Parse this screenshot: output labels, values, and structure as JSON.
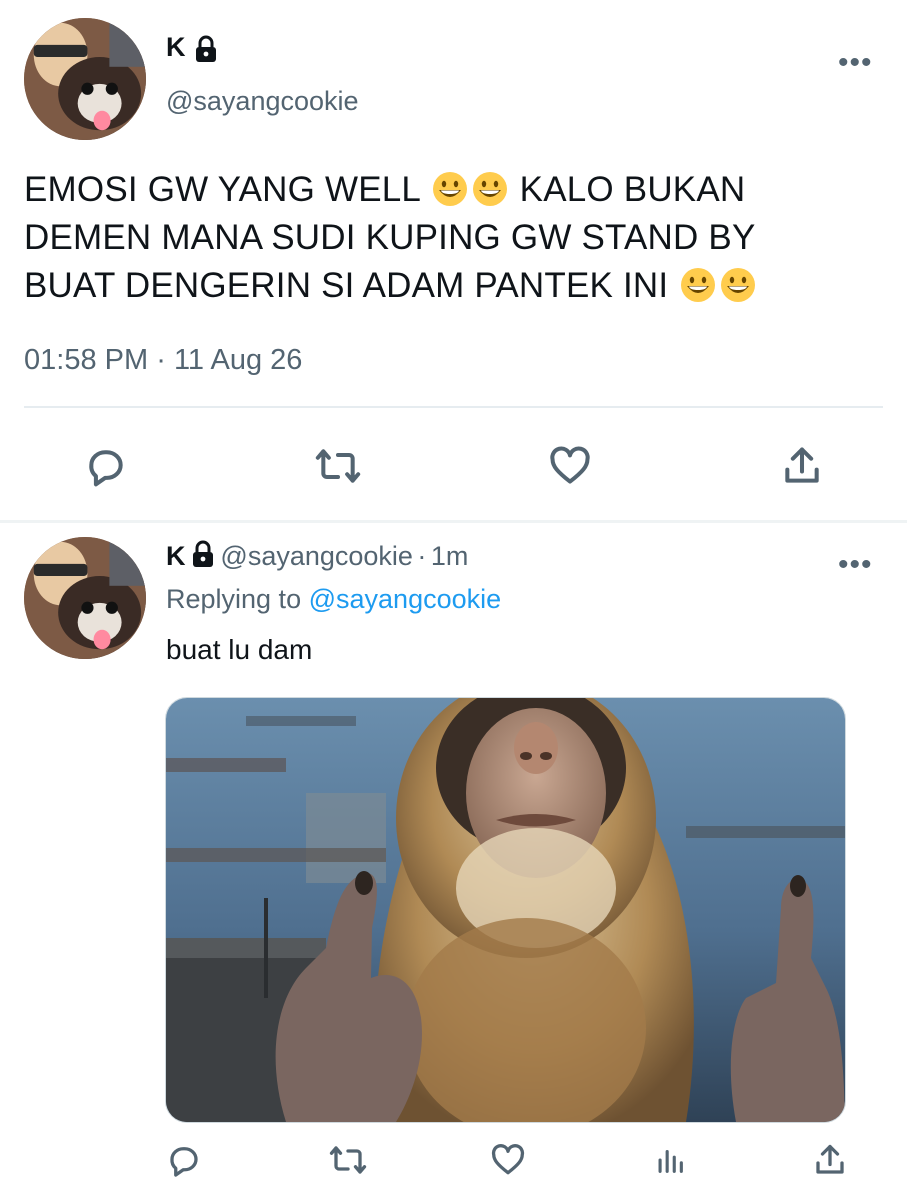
{
  "main_tweet": {
    "author_name": "K",
    "author_handle": "@sayangcookie",
    "text_line1": "EMOSI GW YANG WELL",
    "text_line1b": "KALO BUKAN",
    "text_line2": "DEMEN MANA SUDI KUPING GW STAND BY",
    "text_line3": "BUAT DENGERIN SI ADAM PANTEK INI",
    "time": "01:58 PM",
    "separator": "·",
    "date": "11 Aug 26",
    "more_label": "•••",
    "actions": [
      "reply-icon",
      "retweet-icon",
      "like-icon",
      "share-icon"
    ]
  },
  "reply_tweet": {
    "author_name": "K",
    "author_handle": "@sayangcookie",
    "separator": "·",
    "age": "1m",
    "replying_to_label": "Replying to",
    "replying_to_handle": "@sayangcookie",
    "text": "buat lu dam",
    "more_label": "•••",
    "media_description_icon": "photo",
    "actions": [
      "reply-icon",
      "retweet-icon",
      "like-icon",
      "analytics-icon",
      "share-icon"
    ]
  },
  "colors": {
    "text": "#0f1419",
    "secondary": "#536471",
    "link": "#1d9bf0",
    "divider": "#e6ecf0"
  }
}
